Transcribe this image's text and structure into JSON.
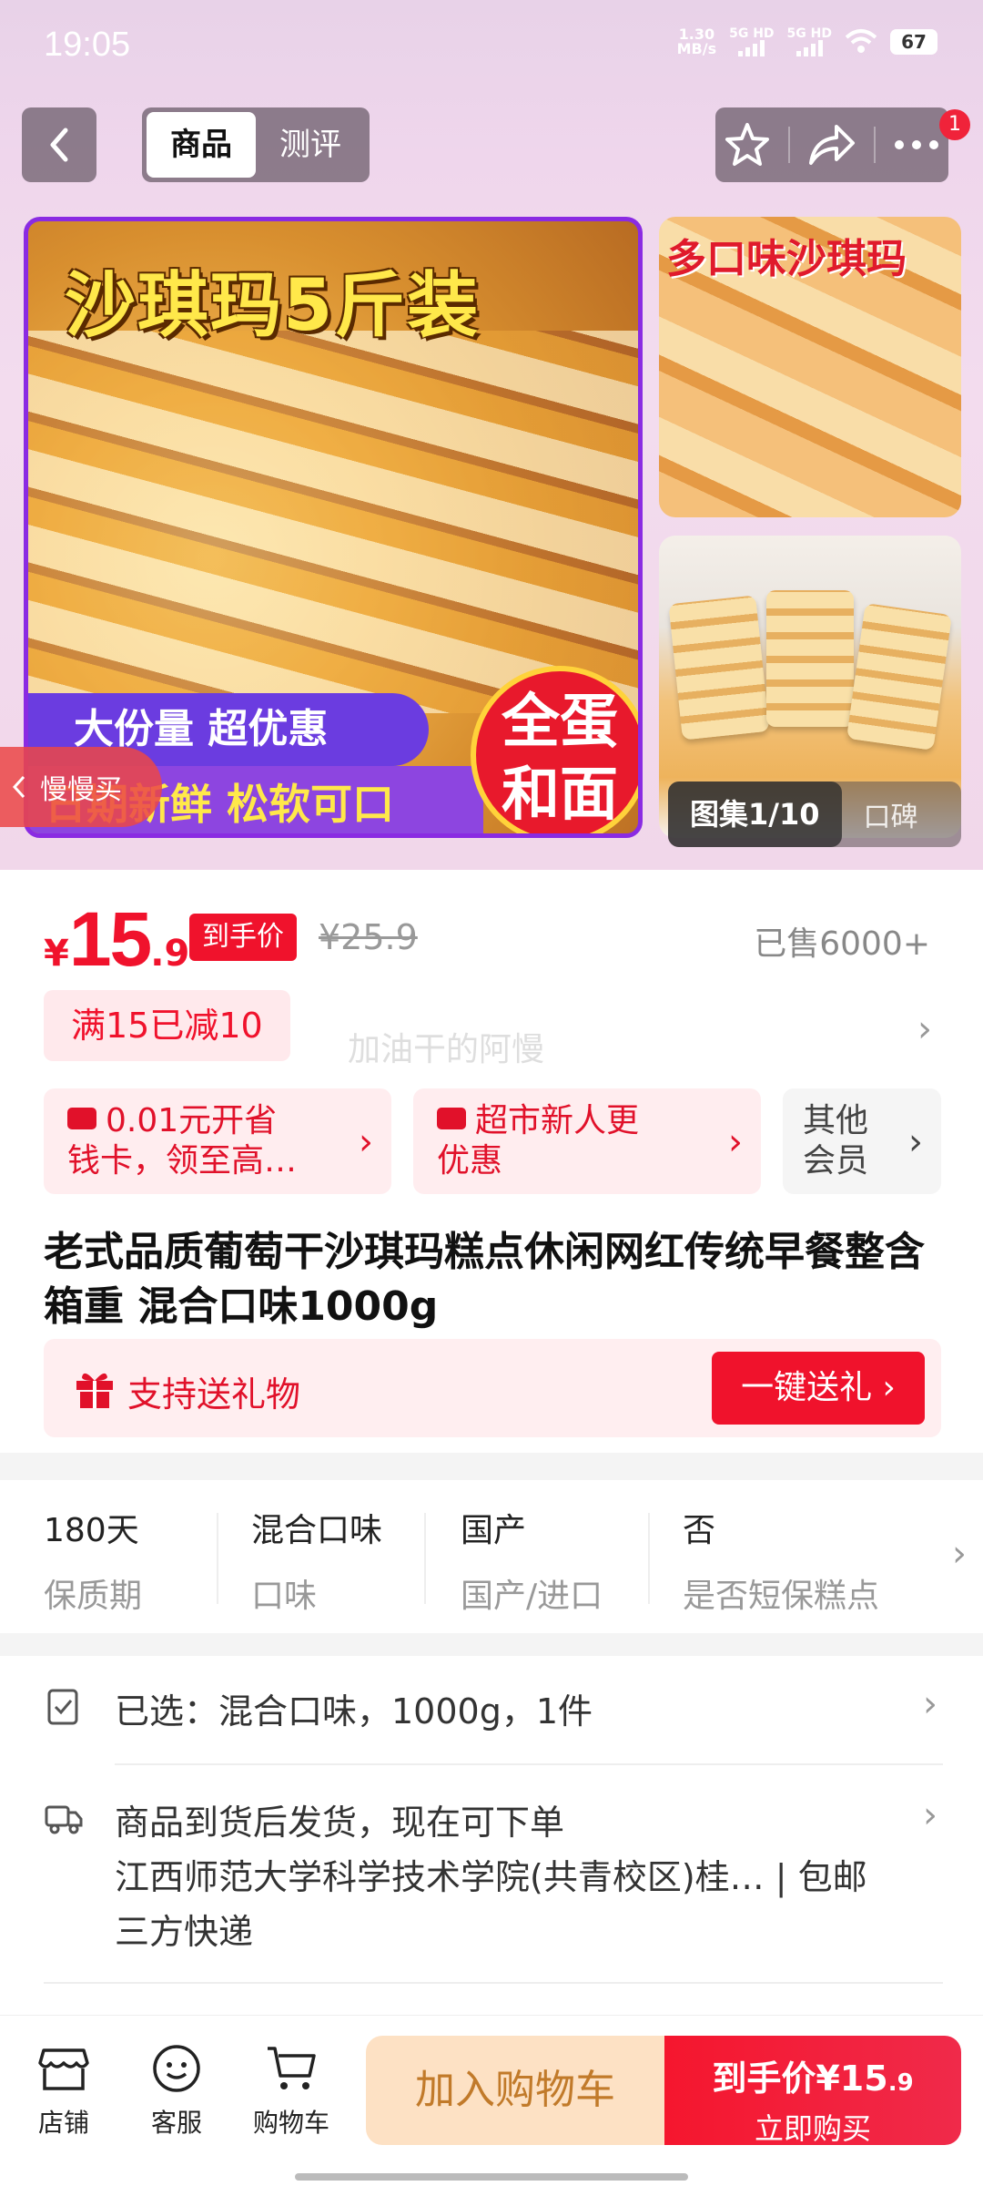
{
  "status": {
    "time": "19:05",
    "speed_top": "1.30",
    "speed_bottom": "MB/s",
    "sig1": "5G HD",
    "sig2": "5G HD",
    "battery": "67"
  },
  "header": {
    "tabs": [
      "商品",
      "测评"
    ],
    "badge_count": "1"
  },
  "gallery": {
    "main_title": "沙琪玛5斤装",
    "ribbon1": "大份量 超优惠",
    "ribbon2": "日期新鲜 松软可口",
    "round_badge_l1": "全蛋",
    "round_badge_l2": "和面",
    "side_title": "多口味沙琪玛",
    "counter": "图集1/10",
    "reviews_label": "口碑",
    "slow_buy": "慢慢买"
  },
  "price": {
    "currency": "¥",
    "integer": "15",
    "decimal": ".9",
    "tag": "到手价",
    "original": "¥25.9",
    "sold": "已售6000+"
  },
  "promo": {
    "discount": "满15已减10",
    "watermark": "加油干的阿慢"
  },
  "coupons": [
    {
      "line1": "0.01元开省",
      "line2": "钱卡，领至高…"
    },
    {
      "line1": "超市新人更",
      "line2": "优惠"
    },
    {
      "line1": "其他",
      "line2": "会员"
    }
  ],
  "product": {
    "title": "老式品质葡萄干沙琪玛糕点休闲网红传统早餐整含箱重 混合口味1000g",
    "gift_text": "支持送礼物",
    "gift_button": "一键送礼 ›"
  },
  "specs": [
    {
      "value": "180天",
      "key": "保质期"
    },
    {
      "value": "混合口味",
      "key": "口味"
    },
    {
      "value": "国产",
      "key": "国产/进口"
    },
    {
      "value": "否",
      "key": "是否短保糕点"
    }
  ],
  "selection": {
    "text": "已选：混合口味，1000g，1件"
  },
  "shipping": {
    "line1": "商品到货后发货，现在可下单",
    "line2": "江西师范大学科学技术学院(共青校区)桂…  | 包邮",
    "line3": "三方快递"
  },
  "bottom": {
    "tabs": [
      "店铺",
      "客服",
      "购物车"
    ],
    "cart_button": "加入购物车",
    "buy_line1": "到手价",
    "buy_price": "¥15",
    "buy_dec": ".9",
    "buy_line2": "立即购买"
  },
  "colors": {
    "accent": "#f0122c",
    "promo_bg": "#ffedef",
    "cart_bg": "#fde1c4"
  }
}
